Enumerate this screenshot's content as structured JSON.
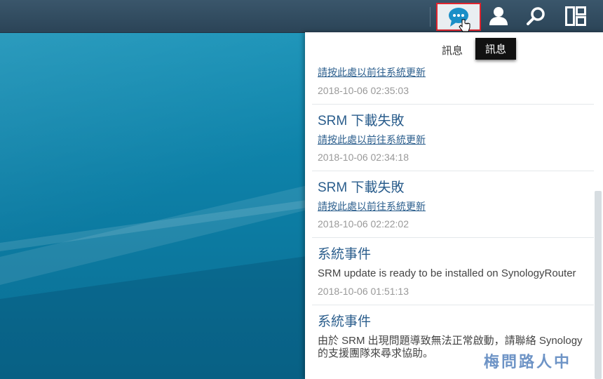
{
  "topbar": {
    "buttons": [
      {
        "name": "messages",
        "icon": "chat-bubble-icon"
      },
      {
        "name": "user",
        "icon": "user-icon"
      },
      {
        "name": "search",
        "icon": "search-icon"
      },
      {
        "name": "widgets",
        "icon": "widget-panel-icon"
      }
    ]
  },
  "tooltip": "訊息",
  "panel_tab_label": "訊息",
  "notifications": [
    {
      "title": "",
      "link": "請按此處以前往系統更新",
      "message": "",
      "time": "2018-10-06 02:35:03"
    },
    {
      "title": "SRM 下載失敗",
      "link": "請按此處以前往系統更新",
      "message": "",
      "time": "2018-10-06 02:34:18"
    },
    {
      "title": "SRM 下載失敗",
      "link": "請按此處以前往系統更新",
      "message": "",
      "time": "2018-10-06 02:22:02"
    },
    {
      "title": "系統事件",
      "link": "",
      "message": "SRM update is ready to be installed on SynologyRouter",
      "time": "2018-10-06 01:51:13"
    },
    {
      "title": "系統事件",
      "link": "",
      "message": "由於 SRM 出現問題導致無法正常啟動，請聯絡 Synology 的支援團隊來尋求協助。",
      "time": ""
    }
  ],
  "watermark": "梅問路人中",
  "colors": {
    "accent": "#1a8fc7",
    "topbar": "#2f4a5e",
    "link": "#2a5d8c",
    "highlight_border": "#e0242e"
  }
}
